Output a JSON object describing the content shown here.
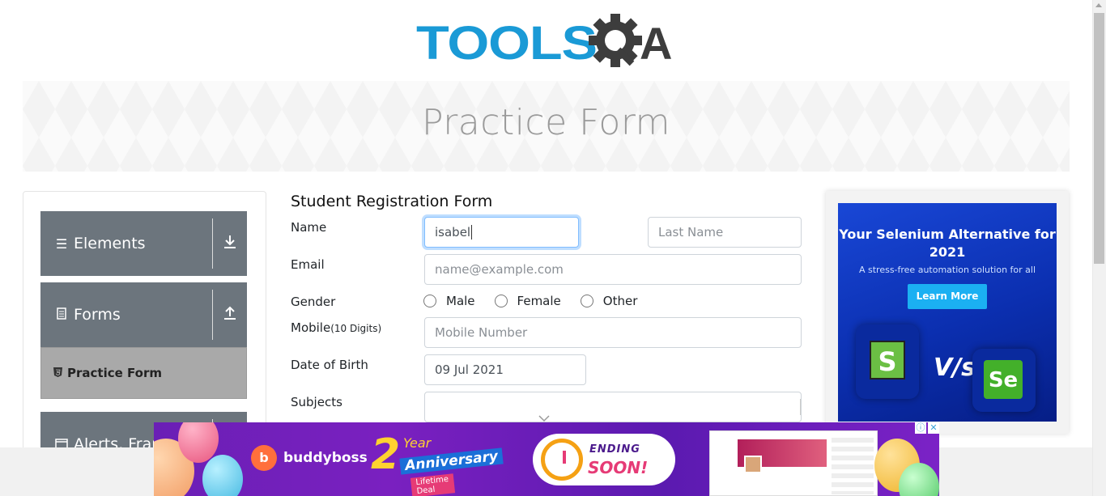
{
  "logo": {
    "tools": "TOOLS",
    "a": "A"
  },
  "banner": {
    "title": "Practice Form"
  },
  "sidebar": {
    "groups": [
      {
        "label": "Elements",
        "icon": "list-icon",
        "arrow": "download-arrow-icon"
      },
      {
        "label": "Forms",
        "icon": "document-icon",
        "arrow": "upload-arrow-icon"
      },
      {
        "label": "Alerts, Frame & Windows",
        "icon": "window-icon",
        "arrow": "download-arrow-icon"
      }
    ],
    "active_item": "Practice Form"
  },
  "form": {
    "title": "Student Registration Form",
    "name_label": "Name",
    "first_name_value": "isabel",
    "last_name_placeholder": "Last Name",
    "email_label": "Email",
    "email_placeholder": "name@example.com",
    "gender_label": "Gender",
    "gender_options": [
      "Male",
      "Female",
      "Other"
    ],
    "mobile_label": "Mobile",
    "mobile_hint": "(10 Digits)",
    "mobile_placeholder": "Mobile Number",
    "dob_label": "Date of Birth",
    "dob_value": "09 Jul 2021",
    "subjects_label": "Subjects",
    "subjects_value": ""
  },
  "right_ad": {
    "headline": "Your Selenium Alternative for 2021",
    "subline": "A stress-free automation solution for all",
    "button": "Learn More",
    "tile1": "S",
    "vs": "V/s",
    "tile2": "Se"
  },
  "bottom_ad": {
    "brand": "buddyboss",
    "anniversary_number": "2",
    "anniversary_year": "Year",
    "anniversary_text": "Anniversary",
    "deal": "Lifetime Deal",
    "ending_line1": "ENDING",
    "ending_line2": "SOON!",
    "info_icon": "ⓘ",
    "close_icon": "✕"
  },
  "colors": {
    "accent": "#1a9ad6",
    "sidebar_group": "#6c757d",
    "sidebar_active": "#a9a9a9",
    "focus_border": "#80bdff"
  }
}
